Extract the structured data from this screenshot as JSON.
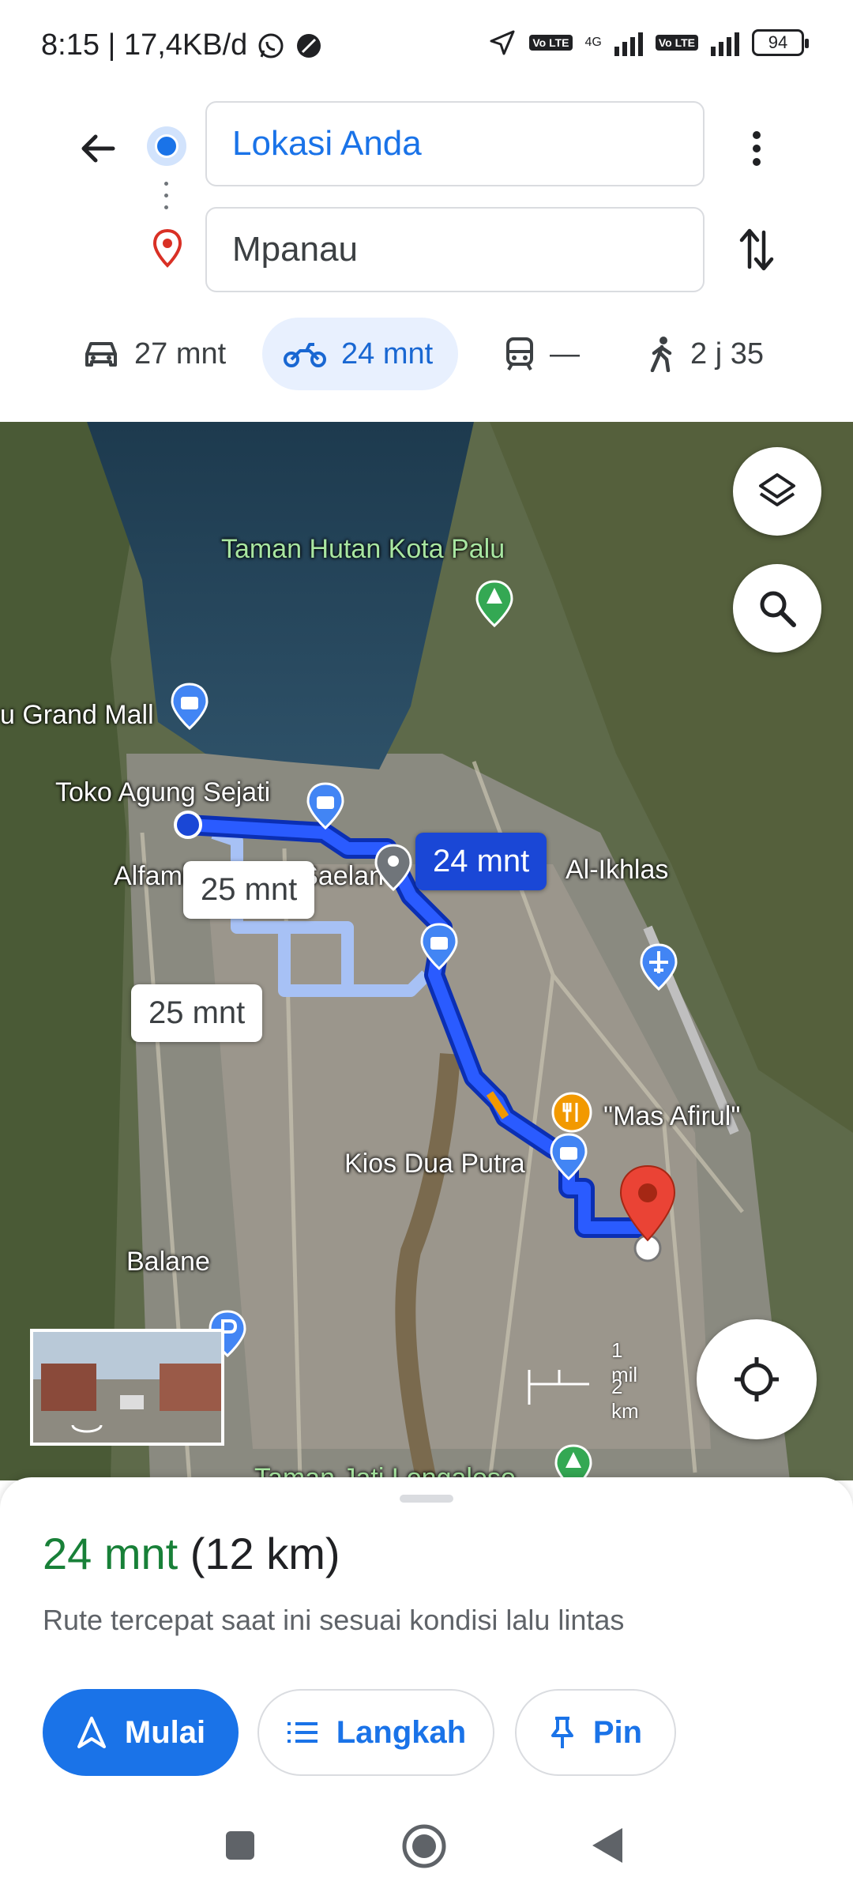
{
  "status_bar": {
    "time_info": "8:15 | 17,4KB/d",
    "network": "4G",
    "volte_label": "Vo LTE",
    "battery": "94"
  },
  "route": {
    "origin": "Lokasi Anda",
    "destination": "Mpanau"
  },
  "modes": [
    {
      "icon": "car-icon",
      "label": "27 mnt",
      "active": false
    },
    {
      "icon": "motorcycle-icon",
      "label": "24 mnt",
      "active": true
    },
    {
      "icon": "transit-icon",
      "label": "—",
      "active": false
    },
    {
      "icon": "walk-icon",
      "label": "2 j 35",
      "active": false
    }
  ],
  "map": {
    "labels": {
      "park": "Taman Hutan Kota Palu",
      "mall": "u Grand Mall",
      "toko": "Toko Agung Sejati",
      "alfamidi": "Alfamidi Emmy Saelan",
      "ikhlas": "Al-Ikhlas",
      "afirul": "\"Mas Afirul\"",
      "kios": "Kios Dua Putra",
      "balane": "Balane",
      "jati": "Taman Jati Longaloso"
    },
    "eta_primary": "24 mnt",
    "eta_alt_1": "25 mnt",
    "eta_alt_2": "25 mnt",
    "scale_mi": "1 mil",
    "scale_km": "2 km"
  },
  "sheet": {
    "duration": "24 mnt",
    "distance": "(12 km)",
    "description": "Rute tercepat saat ini sesuai kondisi lalu lintas",
    "start_label": "Mulai",
    "steps_label": "Langkah",
    "pin_label": "Pin"
  },
  "colors": {
    "accent": "#1a73e8",
    "route": "#1a47d6",
    "alt_route": "#a7c1f5",
    "duration_green": "#188038"
  }
}
